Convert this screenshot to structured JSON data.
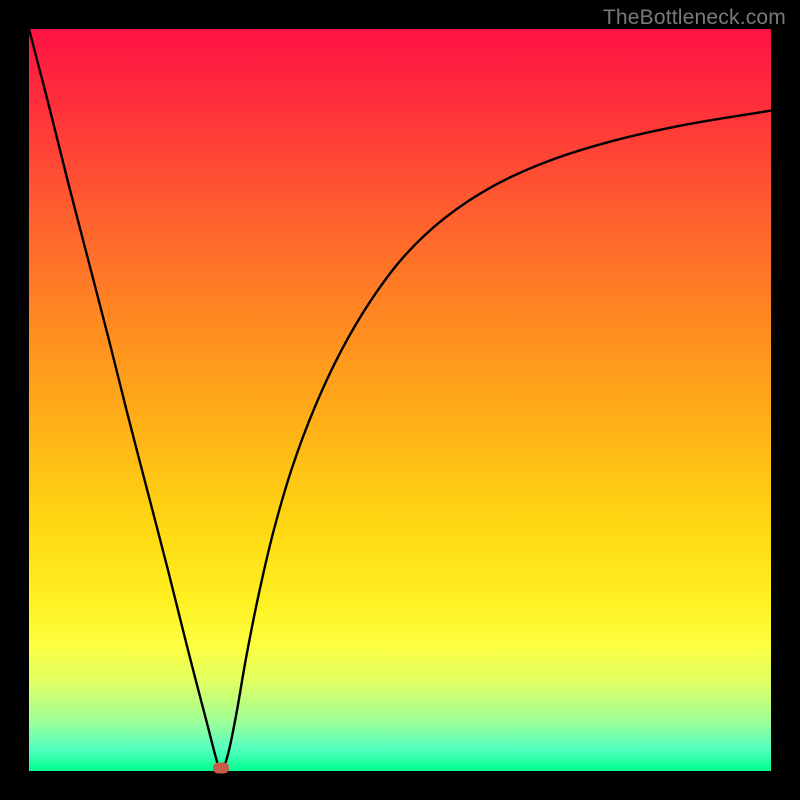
{
  "watermark": "TheBottleneck.com",
  "chart_data": {
    "type": "line",
    "title": "",
    "xlabel": "",
    "ylabel": "",
    "xlim": [
      0,
      100
    ],
    "ylim": [
      0,
      100
    ],
    "grid": false,
    "background_gradient": {
      "orientation": "vertical",
      "stops": [
        {
          "pos": 0.0,
          "color": "#ff1243"
        },
        {
          "pos": 0.1,
          "color": "#ff2f3b"
        },
        {
          "pos": 0.25,
          "color": "#ff5f2f"
        },
        {
          "pos": 0.4,
          "color": "#ff8b20"
        },
        {
          "pos": 0.55,
          "color": "#ffb516"
        },
        {
          "pos": 0.67,
          "color": "#ffd813"
        },
        {
          "pos": 0.77,
          "color": "#fff021"
        },
        {
          "pos": 0.83,
          "color": "#fdff40"
        },
        {
          "pos": 0.88,
          "color": "#e0ff63"
        },
        {
          "pos": 0.93,
          "color": "#a2ff95"
        },
        {
          "pos": 0.97,
          "color": "#55ffc0"
        },
        {
          "pos": 1.0,
          "color": "#00ff8d"
        }
      ]
    },
    "series": [
      {
        "name": "bottleneck-curve",
        "color": "#000000",
        "x": [
          0.0,
          2.7,
          5.3,
          8.0,
          10.7,
          13.3,
          16.0,
          18.7,
          21.3,
          24.0,
          25.6,
          26.2,
          27.0,
          28.0,
          29.3,
          31.0,
          33.0,
          35.5,
          38.5,
          42.0,
          46.0,
          50.5,
          56.0,
          62.5,
          70.0,
          79.0,
          89.0,
          100.0
        ],
        "y": [
          100.0,
          89.6,
          79.2,
          68.8,
          58.4,
          48.0,
          37.6,
          27.2,
          16.8,
          6.4,
          0.4,
          0.4,
          3.0,
          8.0,
          15.5,
          24.0,
          32.5,
          41.0,
          49.0,
          56.5,
          63.3,
          69.3,
          74.5,
          78.8,
          82.2,
          85.0,
          87.2,
          89.0
        ]
      }
    ],
    "marker": {
      "x": 25.9,
      "y": 0.4,
      "color": "#c85a4a"
    }
  }
}
